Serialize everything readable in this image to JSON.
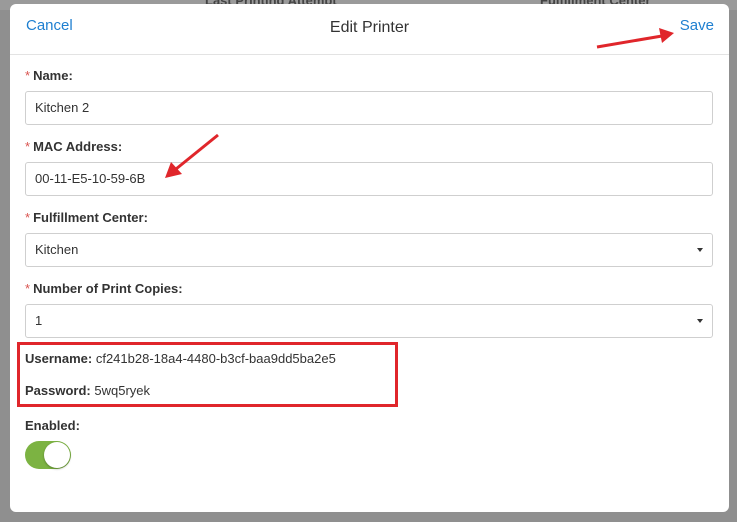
{
  "background": {
    "col1_header": "Last Printing Attempt",
    "col2_header": "Fulfillment Center"
  },
  "header": {
    "cancel_label": "Cancel",
    "title": "Edit Printer",
    "save_label": "Save"
  },
  "form": {
    "required_marker": "*",
    "name_label": "Name:",
    "name_value": "Kitchen 2",
    "mac_label": "MAC Address:",
    "mac_value": "00-11-E5-10-59-6B",
    "fulfillment_label": "Fulfillment Center:",
    "fulfillment_value": "Kitchen",
    "copies_label": "Number of Print Copies:",
    "copies_value": "1",
    "username_label": "Username:",
    "username_value": "cf241b28-18a4-4480-b3cf-baa9dd5ba2e5",
    "password_label": "Password:",
    "password_value": "5wq5ryek",
    "enabled_label": "Enabled:",
    "enabled": true
  },
  "colors": {
    "link": "#1e7fd0",
    "annotation_red": "#e0262b",
    "toggle_on": "#7cb342",
    "required": "#d9534f"
  }
}
